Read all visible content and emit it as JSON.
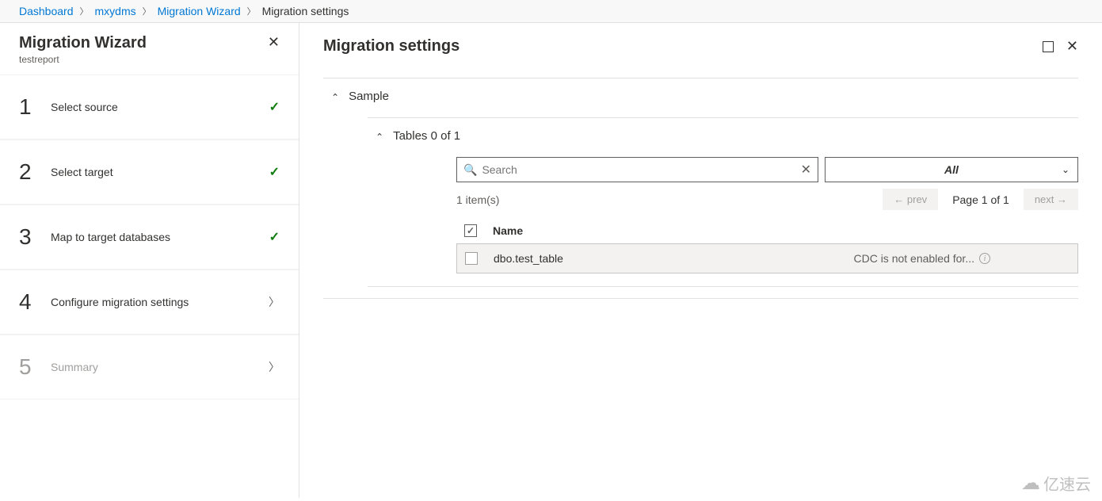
{
  "breadcrumb": {
    "items": [
      "Dashboard",
      "mxydms",
      "Migration Wizard"
    ],
    "current": "Migration settings"
  },
  "sidebar": {
    "title": "Migration Wizard",
    "subtitle": "testreport",
    "steps": [
      {
        "num": "1",
        "label": "Select source",
        "state": "done"
      },
      {
        "num": "2",
        "label": "Select target",
        "state": "done"
      },
      {
        "num": "3",
        "label": "Map to target databases",
        "state": "done"
      },
      {
        "num": "4",
        "label": "Configure migration settings",
        "state": "next"
      },
      {
        "num": "5",
        "label": "Summary",
        "state": "disabled"
      }
    ]
  },
  "page": {
    "title": "Migration settings"
  },
  "section": {
    "label": "Sample",
    "tables_label": "Tables 0 of 1"
  },
  "search": {
    "placeholder": "Search"
  },
  "filter": {
    "value": "All"
  },
  "pagination": {
    "count_label": "1 item(s)",
    "prev": "← prev",
    "page_label": "Page 1 of 1",
    "next": "next →"
  },
  "table": {
    "header_name": "Name",
    "rows": [
      {
        "name": "dbo.test_table",
        "status": "CDC is not enabled for..."
      }
    ]
  },
  "watermark": "亿速云"
}
